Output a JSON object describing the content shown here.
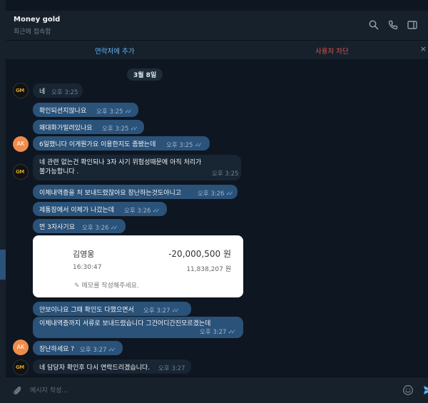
{
  "header": {
    "title": "Money gold",
    "status": "최근에 접속함"
  },
  "actions": {
    "add_contact": "연락처에 추가",
    "block_user": "사용자 차단",
    "close": "×"
  },
  "chat": {
    "date": "3월 8일",
    "avatars": {
      "seller": "GM",
      "me": "AK"
    },
    "messages": [
      {
        "text": "네",
        "time": "오후 3:25"
      },
      {
        "text": "확인되션지않나요",
        "time": "오후 3:25"
      },
      {
        "text": "왜대화가밀려있나요",
        "time": "오후 3:25"
      },
      {
        "text": "6일했니다 이게뭔가요 이용한지도 좀됐는데",
        "time": "오후 3:25"
      },
      {
        "text_line1": "네 관련 없는건 확인되나 3자 사기 위험성때문에 아직 처리가",
        "text_line2": "불가능합니다 .",
        "time": "오후 3:25"
      },
      {
        "text": "이체내역증을 처 보내드렸잖아요 장난하는것도아니고",
        "time": "오후 3:26"
      },
      {
        "text": "제통장에서 이체가 나갔는데",
        "time": "오후 3:26"
      },
      {
        "text": "먼 3자사기요",
        "time": "오후 3:26"
      },
      {
        "text": "안보이나요 그때 확인도 다했으면서",
        "time": "오후 3:27"
      },
      {
        "text": "이체내역증까지 서류로 보내드렸습니다 그건어디간진모르겠는데",
        "time": "오후 3:27"
      },
      {
        "text": "장난하세요 ?",
        "time": "오후 3:27"
      },
      {
        "text": "네 담당자 확인후 다시 연락드리겠습니다.",
        "time": "오후 3:27"
      }
    ],
    "transfer_card": {
      "name": "김영웅",
      "amount": "-20,000,500 원",
      "time": "16:30:47",
      "balance": "11,838,207 원",
      "memo": "메모를 작성해주세요."
    }
  },
  "input": {
    "placeholder": "메시지 작성..."
  },
  "colors": {
    "background": "#0e1621",
    "panel": "#17212b",
    "outgoing_bubble": "#2b5278",
    "incoming_bubble": "#182533",
    "accent": "#5eb5f7",
    "danger": "#e05353"
  }
}
